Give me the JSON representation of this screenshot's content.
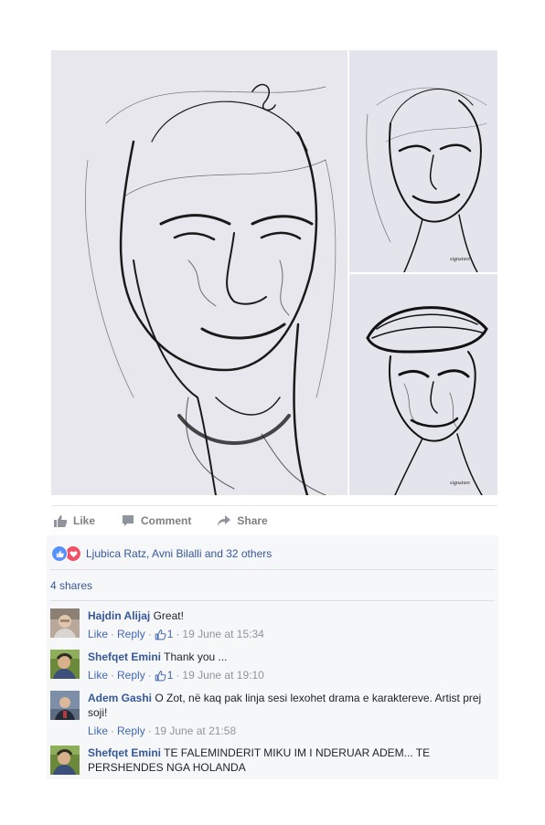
{
  "post": {
    "photos": [
      {
        "icon": "charcoal-portrait-young-man"
      },
      {
        "icon": "charcoal-portrait-older-man"
      },
      {
        "icon": "charcoal-portrait-man-with-cap"
      }
    ],
    "actions": {
      "like": "Like",
      "comment": "Comment",
      "share": "Share"
    },
    "reactions": {
      "text": "Ljubica Ratz, Avni Bilalli and 32 others",
      "colors": {
        "like": "#5890ff",
        "love": "#f25268"
      }
    },
    "shares": "4 shares"
  },
  "comments": [
    {
      "name": "Hajdin Alijaj",
      "text": "Great!",
      "like": "Like",
      "reply": "Reply",
      "likes": "1",
      "time": "19 June at 15:34"
    },
    {
      "name": "Shefqet Emini",
      "text": "Thank you ...",
      "like": "Like",
      "reply": "Reply",
      "likes": "1",
      "time": "19 June at 19:10"
    },
    {
      "name": "Adem Gashi",
      "text": "O Zot, në kaq pak linja sesi lexohet drama e karaktereve. Artist prej soji!",
      "like": "Like",
      "reply": "Reply",
      "time": "19 June at 21:58"
    },
    {
      "name": "Shefqet Emini",
      "text": "TE FALEMINDERIT MIKU IM I NDERUAR ADEM... TE PERSHENDES NGA HOLANDA"
    }
  ],
  "colors": {
    "link": "#365899",
    "meta": "#90949c",
    "accent": "#4267b2"
  }
}
